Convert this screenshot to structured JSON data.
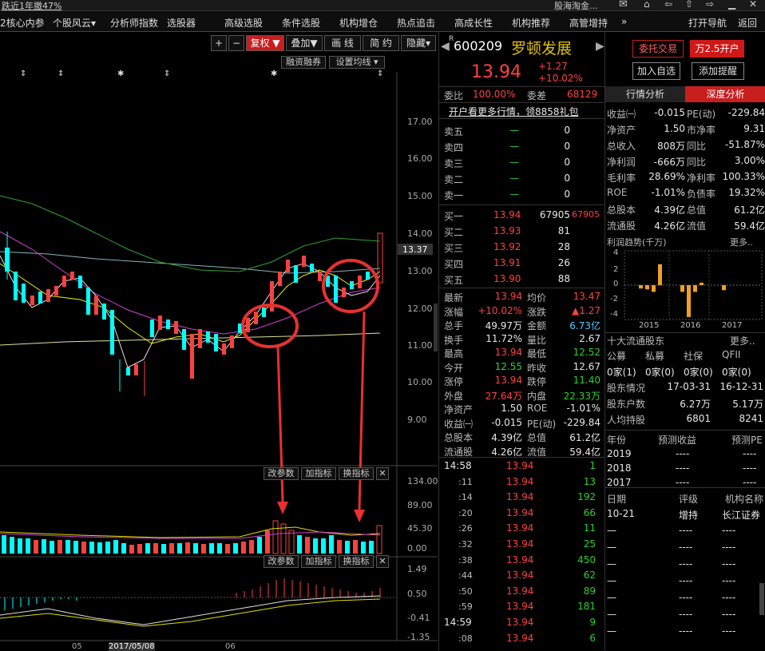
{
  "topbar": {
    "left": "跌近1年撤47%",
    "right": "股海淘金..."
  },
  "nav": {
    "items": [
      "2核心内参",
      "个股风云▾",
      "分析师指数",
      "选股器",
      "高级选股",
      "条件选股",
      "机构增仓",
      "热点追击",
      "高成长性",
      "机构推荐",
      "高管增持",
      "»"
    ],
    "right": [
      "打开导航",
      "返回"
    ]
  },
  "toolbar": {
    "plus": "+",
    "minus": "−",
    "fuquan": "复权 ▼",
    "diejia": "叠加▼",
    "huaxian": "画 线",
    "jianyue": "简 约",
    "yincang": "隐藏▾",
    "rongzi": "融资融券",
    "junxian": "设置均线 ▾"
  },
  "price_axis": [
    "17.00",
    "16.00",
    "15.00",
    "14.00",
    "13.00",
    "12.00",
    "11.00",
    "10.00",
    "9.00"
  ],
  "cur_price_tag": "13.37",
  "vol_panel": {
    "btns": [
      "改参数",
      "加指标",
      "换指标",
      "✕"
    ],
    "axis": [
      "134.00",
      "89.00",
      "45.30",
      "0.00"
    ]
  },
  "macd_panel": {
    "btns": [
      "改参数",
      "加指标",
      "换指标",
      "✕"
    ],
    "axis": [
      "1.49",
      "0.50",
      "-0.41",
      "-1.35"
    ]
  },
  "x_labels": [
    "05",
    "2017/05/08",
    "06"
  ],
  "stock": {
    "code": "600209",
    "name": "罗顿发展",
    "price": "13.94",
    "chg": "+1.27",
    "pct": "+10.02%",
    "wtb": "委比",
    "wtb_v": "100.00%",
    "wc": "委差",
    "wc_v": "68129",
    "promo": "开户看更多行情，领8858礼包"
  },
  "buttons": {
    "weituo": "委托交易",
    "wan": "万2.5开户",
    "addself": "加入自选",
    "alert": "添加提醒"
  },
  "sells": [
    {
      "n": "卖五",
      "p": "—",
      "v": "0"
    },
    {
      "n": "卖四",
      "p": "—",
      "v": "0"
    },
    {
      "n": "卖三",
      "p": "—",
      "v": "0"
    },
    {
      "n": "卖二",
      "p": "—",
      "v": "0"
    },
    {
      "n": "卖一",
      "p": "—",
      "v": "0"
    }
  ],
  "buys": [
    {
      "n": "买一",
      "p": "13.94",
      "v": "67905",
      "x": "67905"
    },
    {
      "n": "买二",
      "p": "13.93",
      "v": "81",
      "x": ""
    },
    {
      "n": "买三",
      "p": "13.92",
      "v": "28",
      "x": ""
    },
    {
      "n": "买四",
      "p": "13.91",
      "v": "26",
      "x": ""
    },
    {
      "n": "买五",
      "p": "13.90",
      "v": "88",
      "x": ""
    }
  ],
  "quote": [
    {
      "a": "最新",
      "av": "13.94",
      "ac": "red",
      "b": "均价",
      "bv": "13.47",
      "bc": "red"
    },
    {
      "a": "涨幅",
      "av": "+10.02%",
      "ac": "red",
      "b": "涨跌",
      "bv": "▲1.27",
      "bc": "red"
    },
    {
      "a": "总手",
      "av": "49.97万",
      "ac": "wh",
      "b": "金额",
      "bv": "6.73亿",
      "bc": "cy"
    },
    {
      "a": "换手",
      "av": "11.72%",
      "ac": "wh",
      "b": "量比",
      "bv": "2.67",
      "bc": "wh"
    },
    {
      "a": "最高",
      "av": "13.94",
      "ac": "red",
      "b": "最低",
      "bv": "12.52",
      "bc": "grn"
    },
    {
      "a": "今开",
      "av": "12.55",
      "ac": "grn",
      "b": "昨收",
      "bv": "12.67",
      "bc": "wh"
    },
    {
      "a": "涨停",
      "av": "13.94",
      "ac": "red",
      "b": "跌停",
      "bv": "11.40",
      "bc": "grn"
    },
    {
      "a": "外盘",
      "av": "27.64万",
      "ac": "red",
      "b": "内盘",
      "bv": "22.33万",
      "bc": "grn"
    },
    {
      "a": "净资产",
      "av": "1.50",
      "ac": "wh",
      "b": "ROE",
      "bv": "-1.01%",
      "bc": "wh"
    },
    {
      "a": "收益㈠",
      "av": "-0.015",
      "ac": "wh",
      "b": "PE(动)",
      "bv": "-229.84",
      "bc": "wh"
    },
    {
      "a": "总股本",
      "av": "4.39亿",
      "ac": "wh",
      "b": "总值",
      "bv": "61.2亿",
      "bc": "wh"
    },
    {
      "a": "流通股",
      "av": "4.26亿",
      "ac": "wh",
      "b": "流值",
      "bv": "59.4亿",
      "bc": "wh"
    }
  ],
  "ticks": [
    {
      "t": "14:58",
      "p": "13.94",
      "v": "1"
    },
    {
      "t": ":11",
      "p": "13.94",
      "v": "13"
    },
    {
      "t": ":14",
      "p": "13.94",
      "v": "192"
    },
    {
      "t": ":20",
      "p": "13.94",
      "v": "66"
    },
    {
      "t": ":26",
      "p": "13.94",
      "v": "11"
    },
    {
      "t": ":32",
      "p": "13.94",
      "v": "25"
    },
    {
      "t": ":38",
      "p": "13.94",
      "v": "450"
    },
    {
      "t": ":44",
      "p": "13.94",
      "v": "62"
    },
    {
      "t": ":50",
      "p": "13.94",
      "v": "89"
    },
    {
      "t": ":59",
      "p": "13.94",
      "v": "181"
    },
    {
      "t": "14:59",
      "p": "13.94",
      "v": "9"
    },
    {
      "t": ":08",
      "p": "13.94",
      "v": "6"
    }
  ],
  "rtabs": [
    "行情分析",
    "深度分析"
  ],
  "fund": [
    {
      "a": "收益㈠",
      "av": "-0.015",
      "b": "PE(动)",
      "bv": "-229.84"
    },
    {
      "a": "净资产",
      "av": "1.50",
      "b": "市净率",
      "bv": "9.31"
    },
    {
      "a": "总收入",
      "av": "808万",
      "b": "同比",
      "bv": "-51.87%"
    },
    {
      "a": "净利润",
      "av": "-666万",
      "b": "同比",
      "bv": "3.00%"
    },
    {
      "a": "毛利率",
      "av": "28.69%",
      "b": "净利率",
      "bv": "100.33%"
    },
    {
      "a": "ROE",
      "av": "-1.01%",
      "b": "负债率",
      "bv": "19.32%"
    },
    {
      "a": "总股本",
      "av": "4.39亿",
      "b": "总值",
      "bv": "61.2亿"
    },
    {
      "a": "流通股",
      "av": "4.26亿",
      "b": "流值",
      "bv": "59.4亿"
    }
  ],
  "profit": {
    "title": "利润趋势(千万)",
    "more": "更多..",
    "yticks": [
      "4",
      "2",
      "0",
      "-2",
      "-4"
    ],
    "years": [
      "2015",
      "2016",
      "2017"
    ]
  },
  "holders": {
    "title": "十大流通股东",
    "more": "更多..",
    "heads": [
      "公募",
      "私募",
      "社保",
      "QFII"
    ],
    "vals": [
      "0家(1)",
      "0家(0)",
      "0家(0)",
      "0家(0)"
    ],
    "r1": [
      "股东情况",
      "17-03-31",
      "16-12-31"
    ],
    "r2": [
      "股东户数",
      "6.27万",
      "5.17万"
    ],
    "r3": [
      "人均持股",
      "6801",
      "8241"
    ]
  },
  "forecast": {
    "heads": [
      "年份",
      "预测收益",
      "预测PE"
    ],
    "rows": [
      [
        "2019",
        "----",
        "----"
      ],
      [
        "2018",
        "----",
        "----"
      ],
      [
        "2017",
        "----",
        "----"
      ]
    ]
  },
  "rating": {
    "heads": [
      "日期",
      "评级",
      "机构名称"
    ],
    "rows": [
      [
        "10-21",
        "增持",
        "长江证券"
      ],
      [
        "—",
        "----",
        "----"
      ],
      [
        "—",
        "----",
        "----"
      ],
      [
        "—",
        "----",
        "----"
      ],
      [
        "—",
        "----",
        "----"
      ],
      [
        "—",
        "----",
        "----"
      ],
      [
        "—",
        "----",
        "----"
      ],
      [
        "—",
        "----",
        "----"
      ]
    ]
  }
}
